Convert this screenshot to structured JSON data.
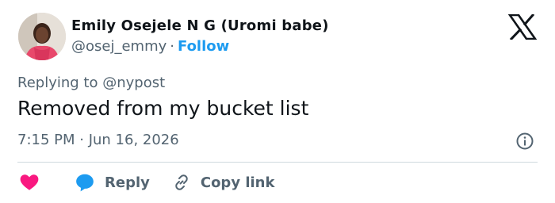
{
  "author": {
    "display_name": "Emily Osejele N G (Uromi babe)",
    "handle": "@osej_emmy",
    "separator": "·",
    "follow_label": "Follow"
  },
  "tweet": {
    "replying_prefix": "Replying to",
    "replying_to": "@nypost",
    "text": "Removed from my bucket list",
    "timestamp": "7:15 PM · Jun 16, 2026"
  },
  "actions": {
    "reply_label": "Reply",
    "copy_link_label": "Copy link"
  },
  "icons": {
    "logo": "x-logo",
    "info": "info-icon",
    "like": "heart-icon",
    "reply": "speech-bubble-icon",
    "copy": "link-icon"
  },
  "colors": {
    "accent": "#1d9bf0",
    "like": "#f91880",
    "text": "#0f1419",
    "secondary": "#536471"
  }
}
